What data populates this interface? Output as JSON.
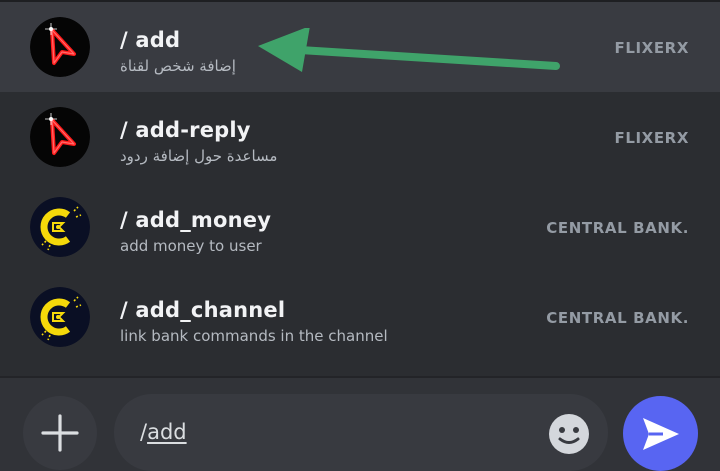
{
  "commands": [
    {
      "name": "/ add",
      "description": "إضافة شخص لقناة",
      "source": "FLIXERX",
      "avatar_icon": "red-cursor-avatar-icon",
      "selected": true
    },
    {
      "name": "/ add-reply",
      "description": "مساعدة حول إضافة ردود",
      "source": "FLIXERX",
      "avatar_icon": "red-cursor-avatar-icon",
      "selected": false
    },
    {
      "name": "/ add_money",
      "description": "add money to user",
      "source": "CENTRAL BANK.",
      "avatar_icon": "yellow-bank-logo-icon",
      "selected": false
    },
    {
      "name": "/ add_channel",
      "description": "link bank commands in the channel",
      "source": "CENTRAL BANK.",
      "avatar_icon": "yellow-bank-logo-icon",
      "selected": false
    }
  ],
  "composer": {
    "slash": "/",
    "typed": "add",
    "plus_icon": "plus-icon",
    "emoji_icon": "smiley-emoji-icon",
    "send_icon": "send-arrow-icon"
  },
  "annotation": {
    "icon": "green-arrow-pointer-icon",
    "color": "#3fa36a"
  },
  "colors": {
    "background": "#2b2d31",
    "selected_row": "#393b41",
    "input": "#383a40",
    "send_button": "#5865f2",
    "text_primary": "#f2f3f5",
    "text_secondary": "#b5bac1",
    "source_text": "#949ba4"
  }
}
